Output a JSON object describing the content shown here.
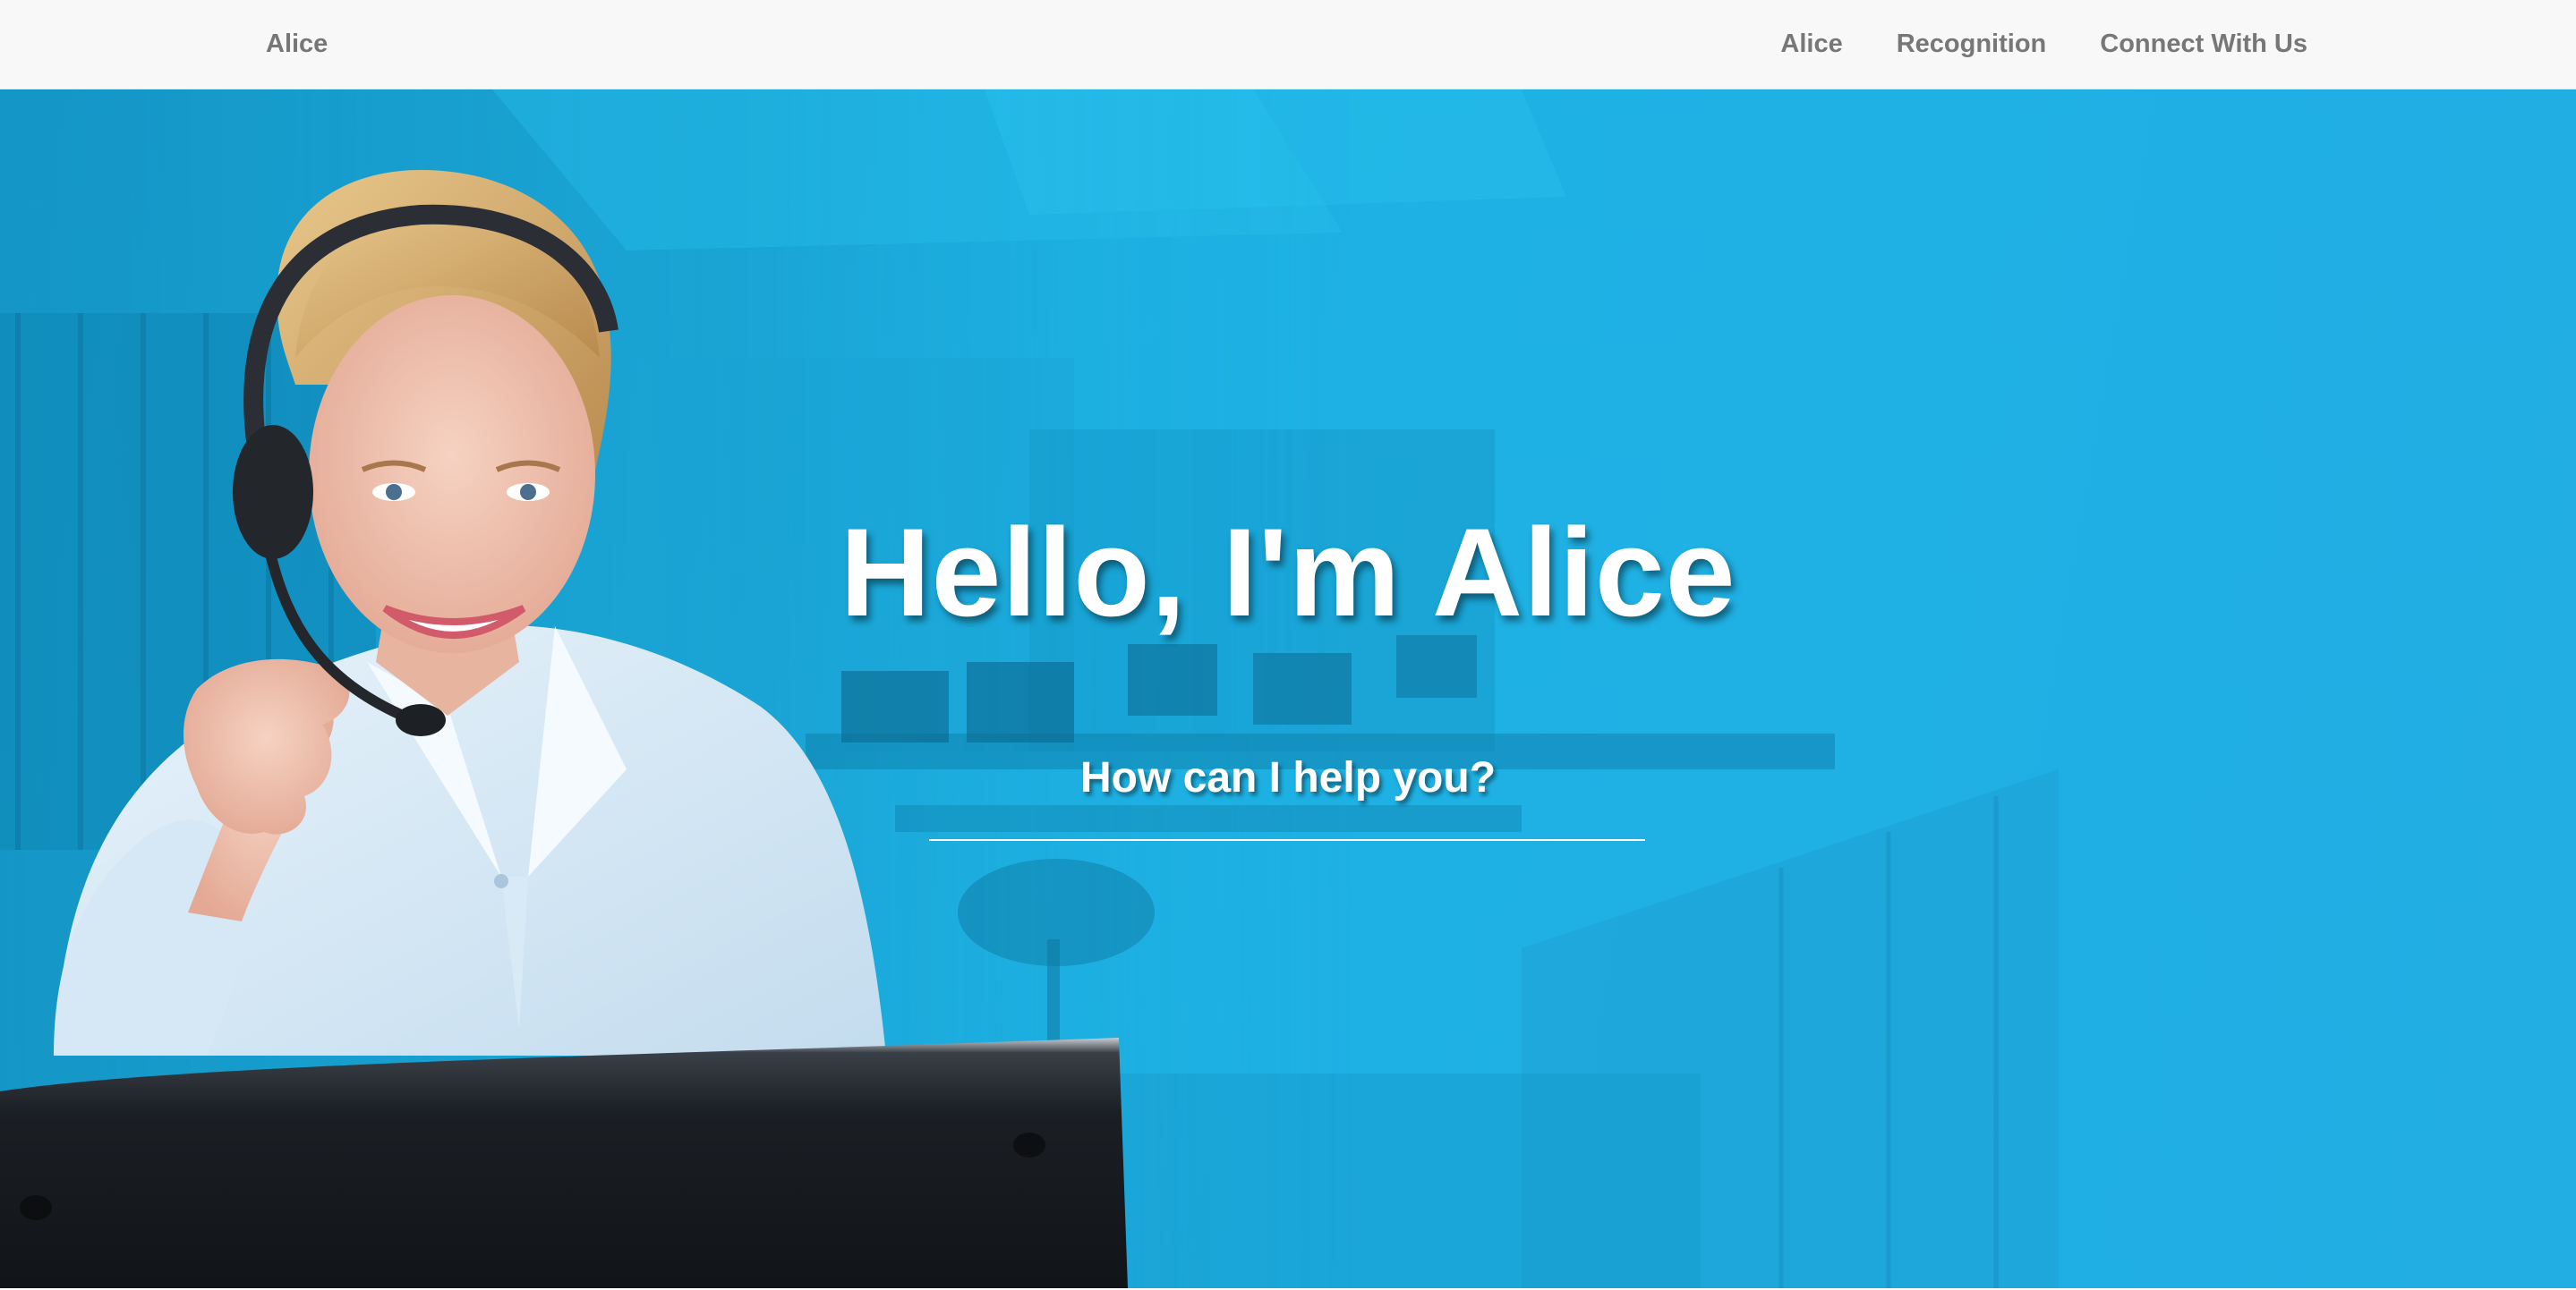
{
  "navbar": {
    "brand": "Alice",
    "links": [
      {
        "label": "Alice"
      },
      {
        "label": "Recognition"
      },
      {
        "label": "Connect With Us"
      }
    ]
  },
  "hero": {
    "title": "Hello, I'm Alice",
    "subtitle": "How can I help you?",
    "background_color": "#1fb0e4",
    "image": "customer-service-agent-with-headset"
  },
  "colors": {
    "navbar_bg": "#f8f8f8",
    "nav_text": "#777777",
    "hero_text": "#ffffff"
  }
}
